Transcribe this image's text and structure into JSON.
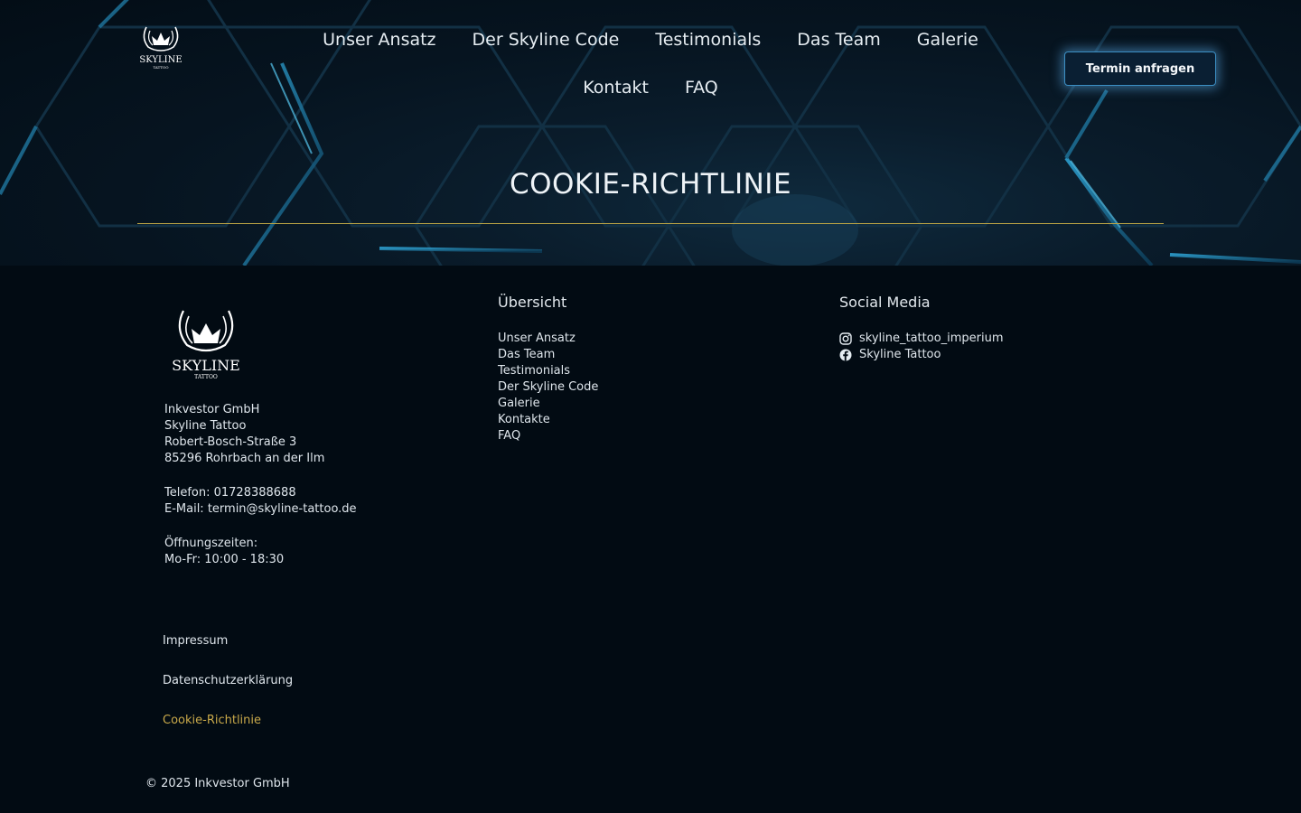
{
  "header": {
    "logo": {
      "text": "SKYLINE",
      "sub": "TATTOO"
    },
    "nav": [
      {
        "label": "Unser Ansatz"
      },
      {
        "label": "Der Skyline Code"
      },
      {
        "label": "Testimonials"
      },
      {
        "label": "Das Team"
      },
      {
        "label": "Galerie"
      },
      {
        "label": "Kontakt"
      },
      {
        "label": "FAQ"
      }
    ],
    "cta_label": "Termin anfragen"
  },
  "hero": {
    "title": "COOKIE-RICHTLINIE"
  },
  "footer": {
    "logo": {
      "text": "SKYLINE",
      "sub": "TATTOO"
    },
    "address": {
      "company": "Inkvestor GmbH",
      "brand": "Skyline Tattoo",
      "street": "Robert-Bosch-Straße 3",
      "city": "85296 Rohrbach an der Ilm",
      "phone": "Telefon: 01728388688",
      "email": "E-Mail: termin@skyline-tattoo.de",
      "hours_label": "Öffnungszeiten:",
      "hours": "Mo-Fr: 10:00 - 18:30"
    },
    "overview": {
      "heading": "Übersicht",
      "links": [
        "Unser Ansatz",
        "Das Team",
        "Testimonials",
        "Der Skyline Code",
        "Galerie",
        "Kontakte",
        "FAQ"
      ]
    },
    "social": {
      "heading": "Social Media",
      "links": [
        {
          "icon": "instagram-icon",
          "label": "skyline_tattoo_imperium"
        },
        {
          "icon": "facebook-icon",
          "label": "Skyline Tattoo"
        }
      ]
    },
    "legal": [
      {
        "label": "Impressum",
        "active": false
      },
      {
        "label": "Datenschutzerklärung",
        "active": false
      },
      {
        "label": "Cookie-Richtlinie",
        "active": true
      }
    ],
    "copyright": "© 2025 Inkvestor GmbH"
  },
  "colors": {
    "accent_gold": "#c9a94a",
    "glow_blue": "#3c8fc4",
    "background": "#020b13"
  }
}
